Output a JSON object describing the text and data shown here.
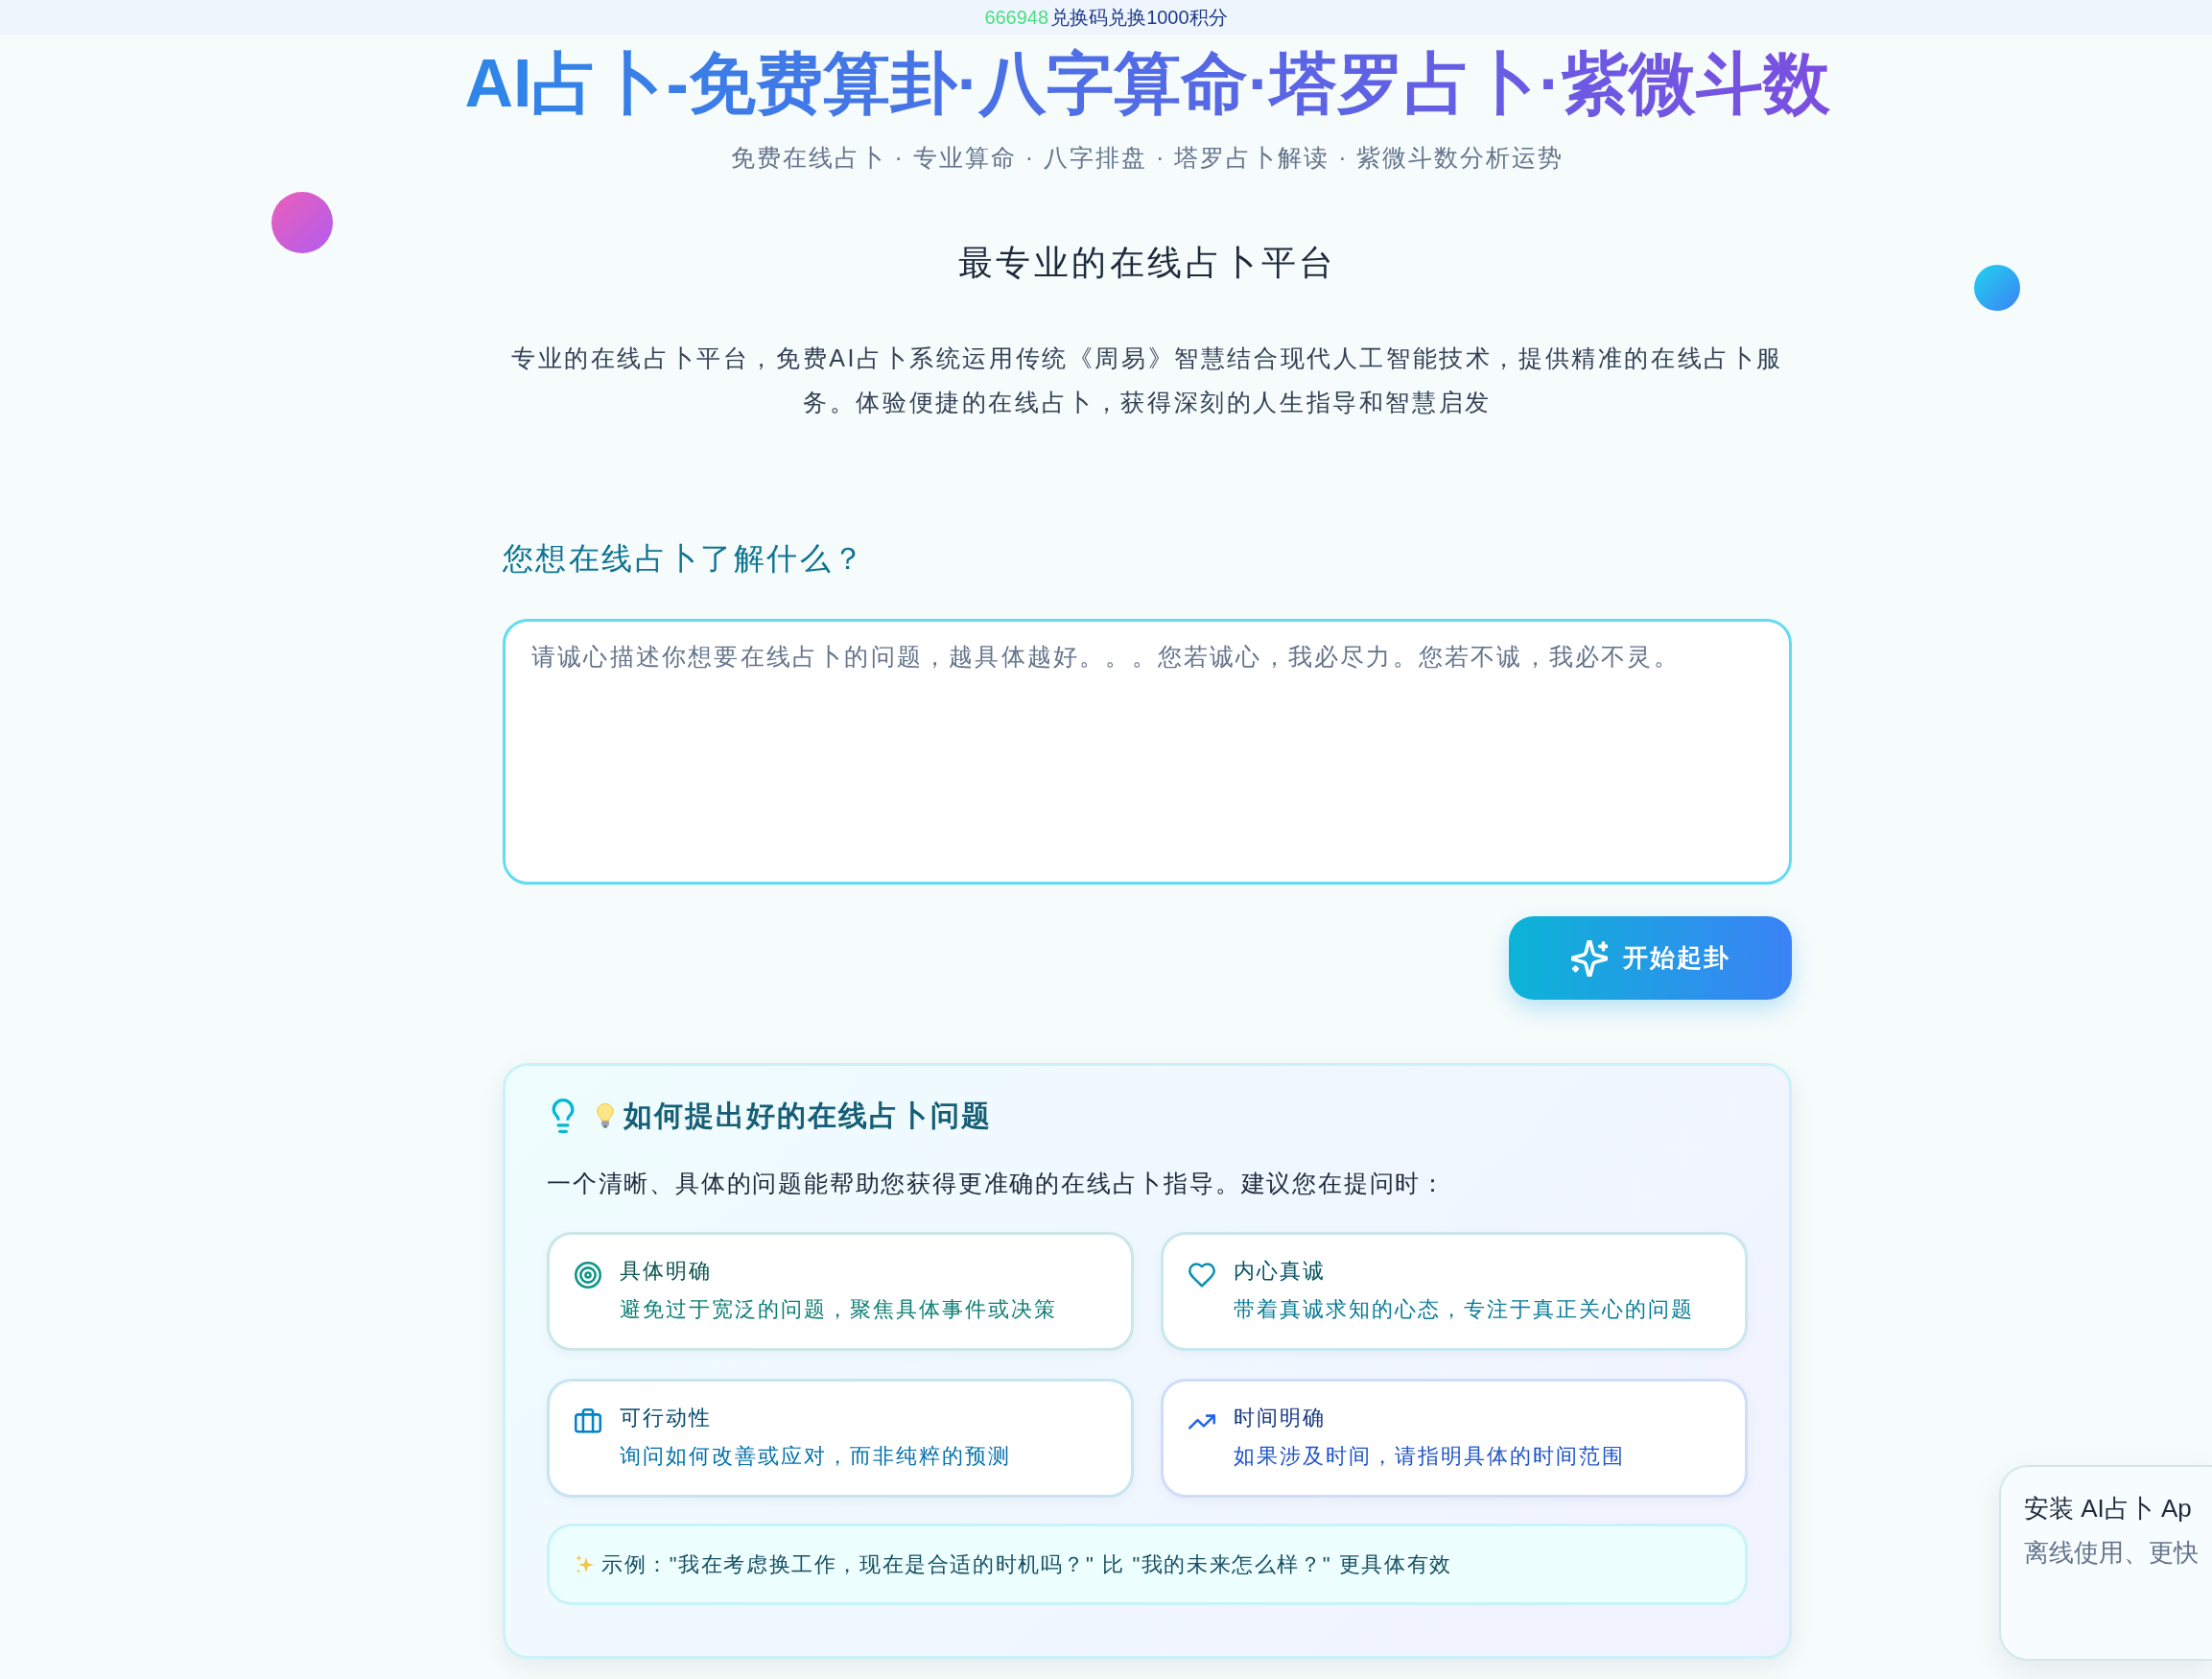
{
  "promo_banner": {
    "code": "666948",
    "text": "兑换码兑换1000积分"
  },
  "header": {
    "title": "AI占卜-免费算卦·八字算命·塔罗占卜·紫微斗数",
    "subtitle": "免费在线占卜 · 专业算命 · 八字排盘 · 塔罗占卜解读 · 紫微斗数分析运势"
  },
  "intro": {
    "heading": "最专业的在线占卜平台",
    "text": "专业的在线占卜平台，免费AI占卜系统运用传统《周易》智慧结合现代人工智能技术，提供精准的在线占卜服务。体验便捷的在线占卜，获得深刻的人生指导和智慧启发"
  },
  "question_form": {
    "label": "您想在线占卜了解什么？",
    "placeholder": "请诚心描述你想要在线占卜的问题，越具体越好。。。您若诚心，我必尽力。您若不诚，我必不灵。",
    "submit_button": "开始起卦"
  },
  "tips": {
    "title": "如何提出好的在线占卜问题",
    "description": "一个清晰、具体的问题能帮助您获得更准确的在线占卜指导。建议您在提问时：",
    "items": [
      {
        "kind": "target",
        "title": "具体明确",
        "text": "避免过于宽泛的问题，聚焦具体事件或决策",
        "color": "#0d9488"
      },
      {
        "kind": "heart",
        "title": "内心真诚",
        "text": "带着真诚求知的心态，专注于真正关心的问题",
        "color": "#0891b2"
      },
      {
        "kind": "briefcase",
        "title": "可行动性",
        "text": "询问如何改善或应对，而非纯粹的预测",
        "color": "#0284c7"
      },
      {
        "kind": "trend",
        "title": "时间明确",
        "text": "如果涉及时间，请指明具体的时间范围",
        "color": "#2563eb"
      }
    ],
    "example": "示例：\"我在考虑换工作，现在是合适的时机吗？\" 比 \"我的未来怎么样？\" 更具体有效"
  },
  "install_prompt": {
    "title": "安装 AI占卜 Ap",
    "text": "离线使用、更快"
  }
}
